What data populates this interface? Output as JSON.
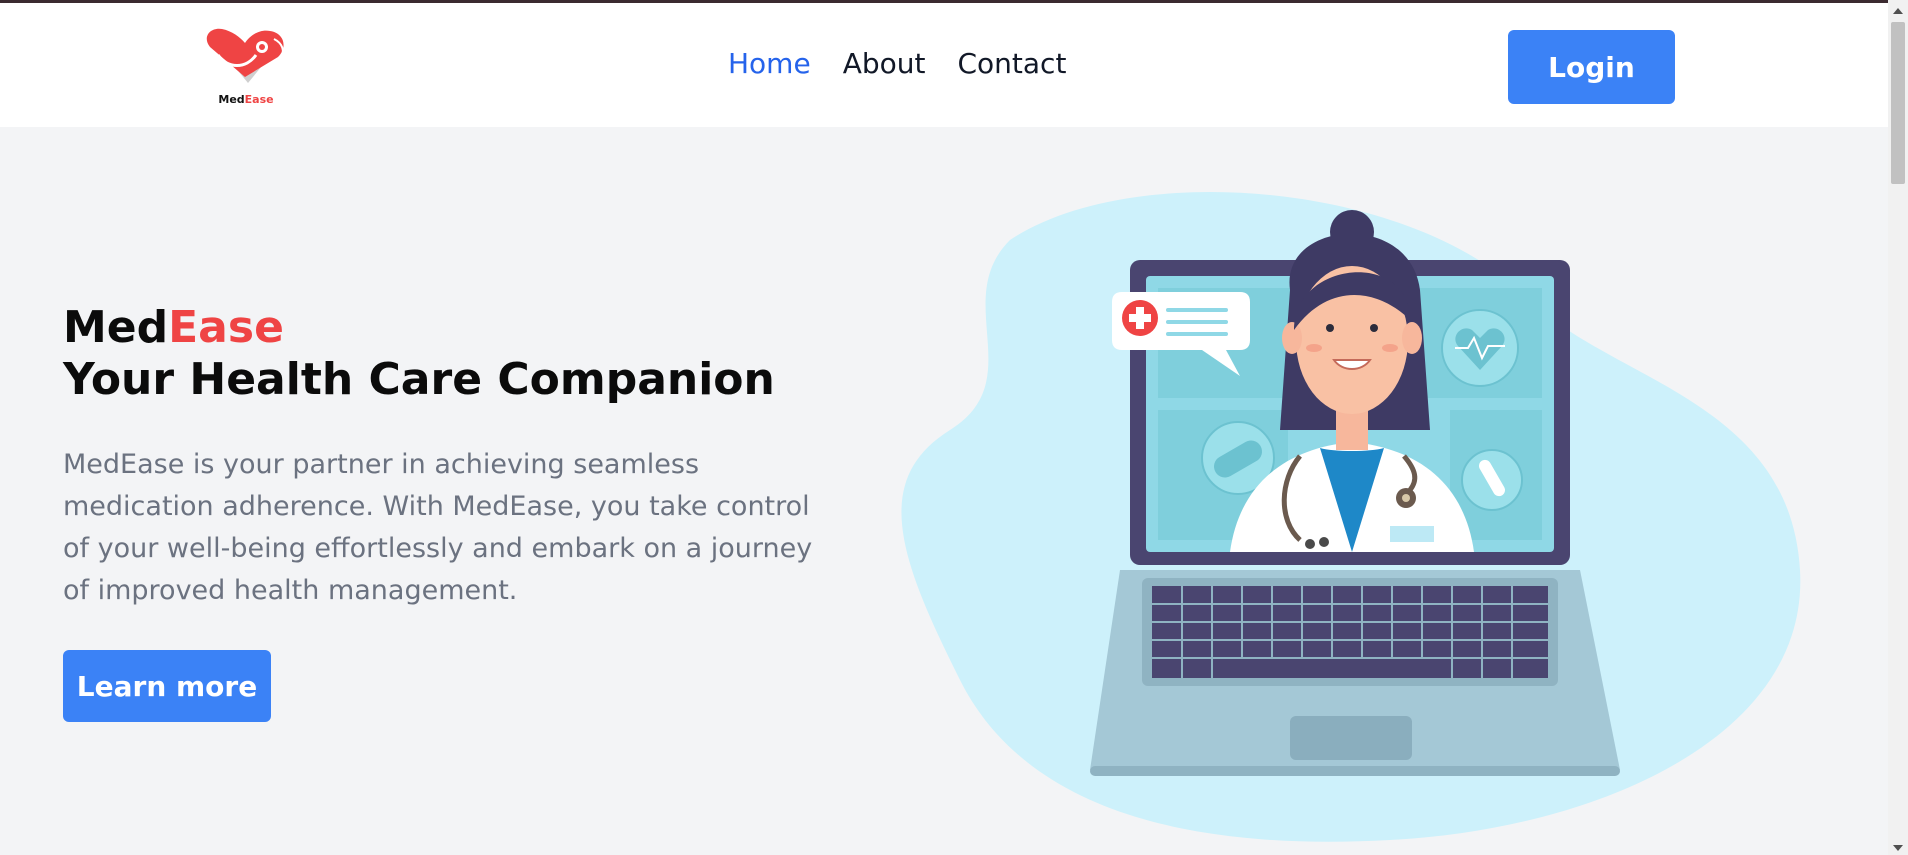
{
  "header": {
    "logo": {
      "part1": "Med",
      "part2": "Ease"
    },
    "nav": [
      {
        "label": "Home",
        "active": true
      },
      {
        "label": "About",
        "active": false
      },
      {
        "label": "Contact",
        "active": false
      }
    ],
    "login_label": "Login"
  },
  "hero": {
    "title_part1": "Med",
    "title_part2": "Ease",
    "subtitle": "Your Health Care Companion",
    "description": "MedEase is your partner in achieving seamless medication adherence. With MedEase, you take control of your well-being effortlessly and embark on a journey of improved health management.",
    "learn_more_label": "Learn more"
  },
  "colors": {
    "accent": "#ef4444",
    "primary": "#3b82f6",
    "nav_active": "#2563eb",
    "background": "#f3f4f6"
  },
  "icons": [
    "heart-logo-icon",
    "doctor-laptop-illustration",
    "medical-cross-icon",
    "heart-rate-icon",
    "pill-icon",
    "test-tube-icon"
  ]
}
